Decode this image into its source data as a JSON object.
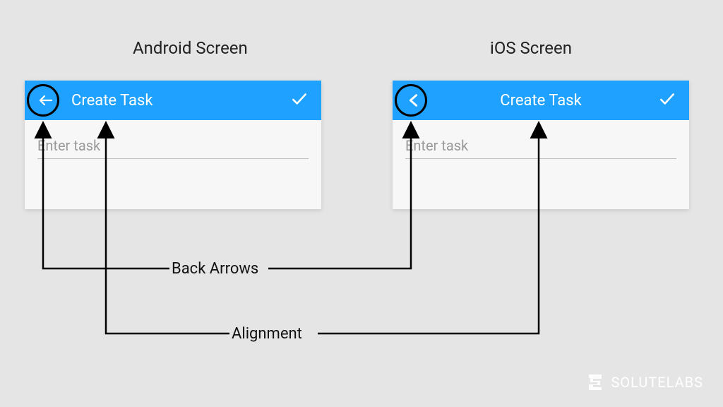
{
  "labels": {
    "android": "Android Screen",
    "ios": "iOS Screen",
    "back_arrows": "Back Arrows",
    "alignment": "Alignment"
  },
  "appbar": {
    "title": "Create Task"
  },
  "input": {
    "placeholder": "Enter task"
  },
  "brand": "SOLUTELABS"
}
